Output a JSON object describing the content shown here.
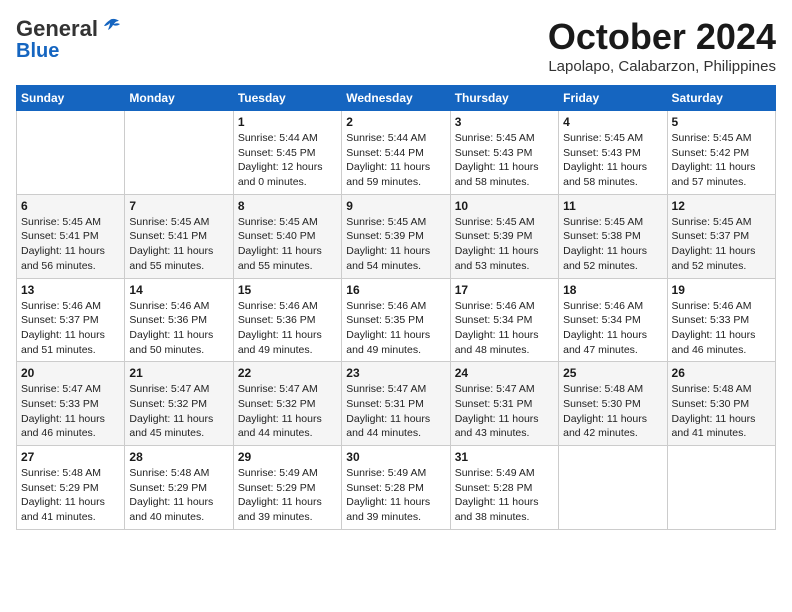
{
  "header": {
    "logo_general": "General",
    "logo_blue": "Blue",
    "month_title": "October 2024",
    "location": "Lapolapo, Calabarzon, Philippines"
  },
  "weekdays": [
    "Sunday",
    "Monday",
    "Tuesday",
    "Wednesday",
    "Thursday",
    "Friday",
    "Saturday"
  ],
  "weeks": [
    [
      {
        "day": "",
        "info": ""
      },
      {
        "day": "",
        "info": ""
      },
      {
        "day": "1",
        "info": "Sunrise: 5:44 AM\nSunset: 5:45 PM\nDaylight: 12 hours\nand 0 minutes."
      },
      {
        "day": "2",
        "info": "Sunrise: 5:44 AM\nSunset: 5:44 PM\nDaylight: 11 hours\nand 59 minutes."
      },
      {
        "day": "3",
        "info": "Sunrise: 5:45 AM\nSunset: 5:43 PM\nDaylight: 11 hours\nand 58 minutes."
      },
      {
        "day": "4",
        "info": "Sunrise: 5:45 AM\nSunset: 5:43 PM\nDaylight: 11 hours\nand 58 minutes."
      },
      {
        "day": "5",
        "info": "Sunrise: 5:45 AM\nSunset: 5:42 PM\nDaylight: 11 hours\nand 57 minutes."
      }
    ],
    [
      {
        "day": "6",
        "info": "Sunrise: 5:45 AM\nSunset: 5:41 PM\nDaylight: 11 hours\nand 56 minutes."
      },
      {
        "day": "7",
        "info": "Sunrise: 5:45 AM\nSunset: 5:41 PM\nDaylight: 11 hours\nand 55 minutes."
      },
      {
        "day": "8",
        "info": "Sunrise: 5:45 AM\nSunset: 5:40 PM\nDaylight: 11 hours\nand 55 minutes."
      },
      {
        "day": "9",
        "info": "Sunrise: 5:45 AM\nSunset: 5:39 PM\nDaylight: 11 hours\nand 54 minutes."
      },
      {
        "day": "10",
        "info": "Sunrise: 5:45 AM\nSunset: 5:39 PM\nDaylight: 11 hours\nand 53 minutes."
      },
      {
        "day": "11",
        "info": "Sunrise: 5:45 AM\nSunset: 5:38 PM\nDaylight: 11 hours\nand 52 minutes."
      },
      {
        "day": "12",
        "info": "Sunrise: 5:45 AM\nSunset: 5:37 PM\nDaylight: 11 hours\nand 52 minutes."
      }
    ],
    [
      {
        "day": "13",
        "info": "Sunrise: 5:46 AM\nSunset: 5:37 PM\nDaylight: 11 hours\nand 51 minutes."
      },
      {
        "day": "14",
        "info": "Sunrise: 5:46 AM\nSunset: 5:36 PM\nDaylight: 11 hours\nand 50 minutes."
      },
      {
        "day": "15",
        "info": "Sunrise: 5:46 AM\nSunset: 5:36 PM\nDaylight: 11 hours\nand 49 minutes."
      },
      {
        "day": "16",
        "info": "Sunrise: 5:46 AM\nSunset: 5:35 PM\nDaylight: 11 hours\nand 49 minutes."
      },
      {
        "day": "17",
        "info": "Sunrise: 5:46 AM\nSunset: 5:34 PM\nDaylight: 11 hours\nand 48 minutes."
      },
      {
        "day": "18",
        "info": "Sunrise: 5:46 AM\nSunset: 5:34 PM\nDaylight: 11 hours\nand 47 minutes."
      },
      {
        "day": "19",
        "info": "Sunrise: 5:46 AM\nSunset: 5:33 PM\nDaylight: 11 hours\nand 46 minutes."
      }
    ],
    [
      {
        "day": "20",
        "info": "Sunrise: 5:47 AM\nSunset: 5:33 PM\nDaylight: 11 hours\nand 46 minutes."
      },
      {
        "day": "21",
        "info": "Sunrise: 5:47 AM\nSunset: 5:32 PM\nDaylight: 11 hours\nand 45 minutes."
      },
      {
        "day": "22",
        "info": "Sunrise: 5:47 AM\nSunset: 5:32 PM\nDaylight: 11 hours\nand 44 minutes."
      },
      {
        "day": "23",
        "info": "Sunrise: 5:47 AM\nSunset: 5:31 PM\nDaylight: 11 hours\nand 44 minutes."
      },
      {
        "day": "24",
        "info": "Sunrise: 5:47 AM\nSunset: 5:31 PM\nDaylight: 11 hours\nand 43 minutes."
      },
      {
        "day": "25",
        "info": "Sunrise: 5:48 AM\nSunset: 5:30 PM\nDaylight: 11 hours\nand 42 minutes."
      },
      {
        "day": "26",
        "info": "Sunrise: 5:48 AM\nSunset: 5:30 PM\nDaylight: 11 hours\nand 41 minutes."
      }
    ],
    [
      {
        "day": "27",
        "info": "Sunrise: 5:48 AM\nSunset: 5:29 PM\nDaylight: 11 hours\nand 41 minutes."
      },
      {
        "day": "28",
        "info": "Sunrise: 5:48 AM\nSunset: 5:29 PM\nDaylight: 11 hours\nand 40 minutes."
      },
      {
        "day": "29",
        "info": "Sunrise: 5:49 AM\nSunset: 5:29 PM\nDaylight: 11 hours\nand 39 minutes."
      },
      {
        "day": "30",
        "info": "Sunrise: 5:49 AM\nSunset: 5:28 PM\nDaylight: 11 hours\nand 39 minutes."
      },
      {
        "day": "31",
        "info": "Sunrise: 5:49 AM\nSunset: 5:28 PM\nDaylight: 11 hours\nand 38 minutes."
      },
      {
        "day": "",
        "info": ""
      },
      {
        "day": "",
        "info": ""
      }
    ]
  ]
}
